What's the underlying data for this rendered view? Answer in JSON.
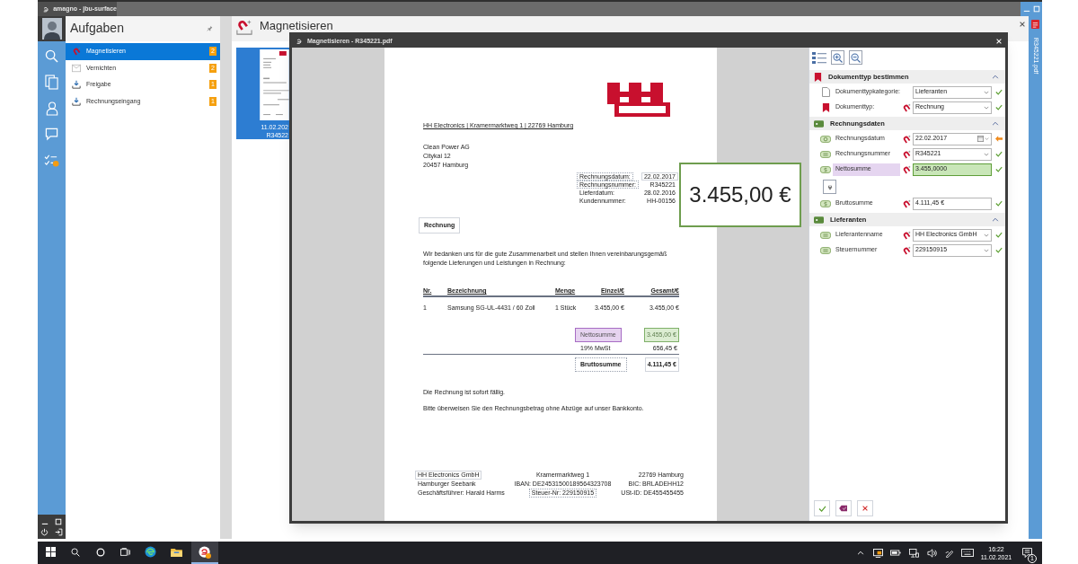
{
  "window": {
    "title": "amagno - jbu-surface"
  },
  "tasks": {
    "title": "Aufgaben",
    "items": [
      {
        "label": "Magnetisieren",
        "count": "2",
        "kind": "magnet",
        "selected": true
      },
      {
        "label": "Vernichten",
        "count": "2",
        "kind": "envelope",
        "selected": false
      },
      {
        "label": "Freigabe",
        "count": "1",
        "kind": "inbox",
        "selected": false
      },
      {
        "label": "Rechnungseingang",
        "count": "1",
        "kind": "inbox",
        "selected": false
      }
    ]
  },
  "view": {
    "title": "Magnetisieren",
    "documents": [
      {
        "date": "11.02.202",
        "name": "R34522",
        "selected": true
      }
    ]
  },
  "side_tab": {
    "label": "R345221.pdf"
  },
  "dialog": {
    "title": "Magnetisieren - R345221.pdf",
    "document": {
      "sender_line": "HH Electronics | Kramermarktweg 1 | 22769 Hamburg",
      "address": [
        "Clean Power AG",
        "Citykai 12",
        "20457 Hamburg"
      ],
      "info": [
        {
          "label": "Rechnungsdatum:",
          "value": "22.02.2017",
          "label_framed": true,
          "value_framed": true
        },
        {
          "label": "Rechnungsnummer:",
          "value": "R345221",
          "label_framed": true,
          "value_framed": false
        },
        {
          "label": "Lieferdatum:",
          "value": "28.02.2016",
          "label_framed": false,
          "value_framed": false
        },
        {
          "label": "Kundennummer:",
          "value": "HH-00156",
          "label_framed": false,
          "value_framed": false
        }
      ],
      "heading": "Rechnung",
      "intro": "Wir bedanken uns für die gute Zusammenarbeit und stellen Ihnen vereinbarungsgemäß folgende Lieferungen und Leistungen in Rechnung:",
      "table": {
        "columns": [
          "Nr.",
          "Bezeichnung",
          "Menge",
          "Einzel/€",
          "Gesamt/€"
        ],
        "rows": [
          [
            "1",
            "Samsung SG-UL-4431 / 60 Zoll",
            "1 Stück",
            "3.455,00 €",
            "3.455,00 €"
          ]
        ]
      },
      "totals": [
        {
          "label": "Nettosumme",
          "value": "3.455,00 €",
          "kind": "matched"
        },
        {
          "label": "19% MwSt",
          "value": "656,45 €",
          "kind": "plain"
        },
        {
          "label": "Bruttosumme",
          "value": "4.111,45 €",
          "kind": "total"
        }
      ],
      "notes": [
        "Die Rechnung ist sofort fällig.",
        "Bitte überweisen Sie den Rechnungsbetrag ohne Abzüge auf unser Bankkonto."
      ],
      "footer": [
        [
          {
            "text": "HH Electronics GmbH",
            "kind": "boxed"
          },
          {
            "text": "Hamburger Seebank",
            "kind": "plain"
          },
          {
            "text": "Geschäftsführer: Harald Harms",
            "kind": "plain"
          }
        ],
        [
          {
            "text": "Kramermarktweg 1",
            "kind": "plain"
          },
          {
            "text": "IBAN: DE24531500189564323708",
            "kind": "plain"
          },
          {
            "text": "Steuer-Nr: 229150915",
            "kind": "dotted"
          }
        ],
        [
          {
            "text": "22769 Hamburg",
            "kind": "plain"
          },
          {
            "text": "BIC: BRLADEHH12",
            "kind": "plain"
          },
          {
            "text": "USt-ID: DE455455455",
            "kind": "plain"
          }
        ]
      ]
    },
    "zoom_preview": "3.455,00 €",
    "panel": {
      "sections": [
        {
          "title": "Dokumenttyp bestimmen",
          "kind": "doctype",
          "expanded": true,
          "fields": [
            {
              "label": "Dokumenttypkategorie:",
              "kind": "category",
              "value": "Lieferanten",
              "magnet": false,
              "confirmed": true,
              "highlighted": false,
              "focused": false,
              "locate_button": false
            },
            {
              "label": "Dokumenttyp:",
              "kind": "doctype",
              "value": "Rechnung",
              "magnet": true,
              "confirmed": true,
              "highlighted": false,
              "focused": false,
              "locate_button": false
            }
          ]
        },
        {
          "title": "Rechnungsdaten",
          "kind": "data",
          "expanded": true,
          "fields": [
            {
              "label": "Rechnungsdatum",
              "kind": "date",
              "value": "22.02.2017",
              "magnet": true,
              "confirmed": false,
              "highlighted": false,
              "focused": false,
              "locate_button": false
            },
            {
              "label": "Rechnungsnummer",
              "kind": "text",
              "value": "R345221",
              "magnet": true,
              "confirmed": true,
              "highlighted": false,
              "focused": false,
              "locate_button": false
            },
            {
              "label": "Nettosumme",
              "kind": "amount",
              "value": "3.455,0000",
              "magnet": true,
              "confirmed": true,
              "highlighted": true,
              "focused": true,
              "locate_button": true
            },
            {
              "label": "Bruttosumme",
              "kind": "amount",
              "value": "4.111,45 €",
              "magnet": true,
              "confirmed": true,
              "highlighted": false,
              "focused": false,
              "locate_button": false
            }
          ]
        },
        {
          "title": "Lieferanten",
          "kind": "data",
          "expanded": true,
          "fields": [
            {
              "label": "Lieferantenname",
              "kind": "text",
              "value": "HH Electronics GmbH",
              "magnet": true,
              "confirmed": true,
              "highlighted": false,
              "focused": false,
              "locate_button": false
            },
            {
              "label": "Steuernummer",
              "kind": "text",
              "value": "229150915",
              "magnet": true,
              "confirmed": true,
              "highlighted": false,
              "focused": false,
              "locate_button": false
            }
          ]
        }
      ]
    }
  },
  "taskbar": {
    "items": [
      {
        "kind": "start",
        "active": false
      },
      {
        "kind": "search",
        "active": false
      },
      {
        "kind": "cortana",
        "active": false
      },
      {
        "kind": "task_view",
        "active": false
      },
      {
        "kind": "browser",
        "active": false
      },
      {
        "kind": "folder",
        "active": false
      },
      {
        "kind": "app",
        "active": true
      }
    ],
    "time": "16:22",
    "date": "11.02.2021",
    "notifications": "1"
  }
}
